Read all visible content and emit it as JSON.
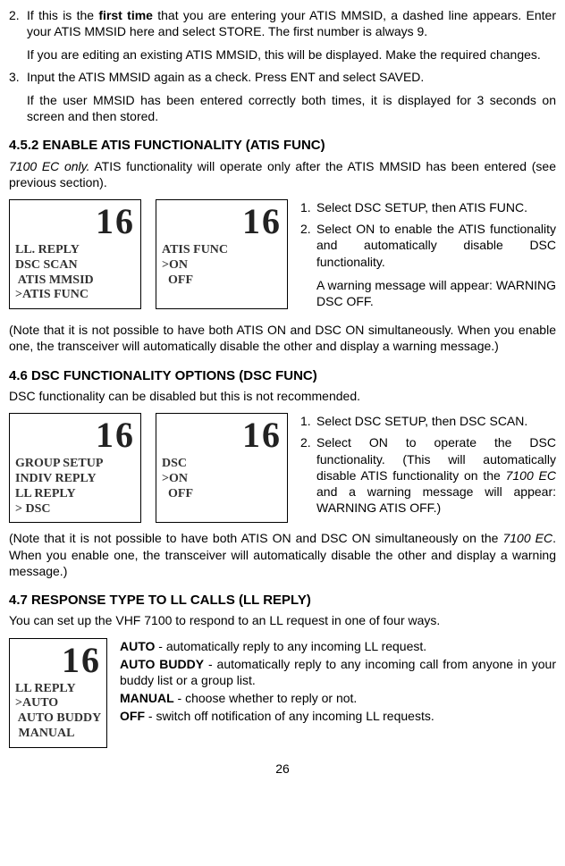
{
  "section_a": {
    "item2_num": "2.",
    "item2_text_pre": "If this is the ",
    "item2_bold": "first time",
    "item2_text_post": " that you are entering your ATIS MMSID, a dashed line appears. Enter your ATIS MMSID here and select STORE. The first number is always 9.",
    "item2_sub": "If you are editing an existing ATIS MMSID, this will be displayed. Make the required changes.",
    "item3_num": "3.",
    "item3_text": "Input the ATIS MMSID again as a check. Press ENT and select SAVED.",
    "item3_sub": "If the user MMSID has been entered correctly both times, it is displayed for 3 seconds on screen and then stored."
  },
  "sec452": {
    "title": "4.5.2 ENABLE ATIS FUNCTIONALITY (ATIS FUNC)",
    "intro_italic": "7100 EC only.",
    "intro_rest": " ATIS functionality will operate only after the ATIS MMSID has been entered (see previous section).",
    "screen1": {
      "ch": "16",
      "l1": "LL. REPLY",
      "l2": "DSC SCAN",
      "l3": " ATIS MMSID",
      "l4": ">ATIS FUNC"
    },
    "screen2": {
      "ch": "16",
      "l1": "ATIS FUNC",
      "l2": ">ON",
      "l3": "  OFF"
    },
    "step1_num": "1.",
    "step1": "Select DSC SETUP, then ATIS FUNC.",
    "step2_num": "2.",
    "step2": "Select ON to enable the ATIS functionality and automatically disable DSC functionality.",
    "step2_sub": "A warning message will appear: WARNING DSC OFF.",
    "note": "(Note that it is not possible to have both ATIS ON and DSC ON simultaneously. When you enable one, the transceiver will automatically disable the other and display a warning message.)"
  },
  "sec46": {
    "title": "4.6 DSC FUNCTIONALITY OPTIONS (DSC FUNC)",
    "intro": "DSC functionality can be disabled but this is not recommended.",
    "screen1": {
      "ch": "16",
      "l1": "GROUP SETUP",
      "l2": "INDIV REPLY",
      "l3": "LL REPLY",
      "l4": "> DSC"
    },
    "screen2": {
      "ch": "16",
      "l1": "DSC",
      "l2": ">ON",
      "l3": "  OFF"
    },
    "step1_num": "1.",
    "step1": "Select DSC SETUP, then DSC SCAN.",
    "step2_num": "2.",
    "step2_a": "Select ON to operate the DSC functionality. (This will automatically disable ATIS functionality  on the ",
    "step2_it": "7100 EC",
    "step2_b": "  and a warning message will appear: WARNING ATIS OFF.)",
    "note_a": "(Note that it is not possible to have both ATIS ON and DSC ON simultaneously on the ",
    "note_it": "7100 EC",
    "note_b": ". When you enable one, the transceiver will automatically disable the other and display a warning message.)"
  },
  "sec47": {
    "title": "4.7 RESPONSE TYPE TO LL CALLS (LL REPLY)",
    "intro": "You can set up the VHF 7100 to respond to an LL request in one of four ways.",
    "screen": {
      "ch": "16",
      "l1": "LL REPLY",
      "l2": ">AUTO",
      "l3": " AUTO BUDDY",
      "l4": " MANUAL"
    },
    "auto_b": "AUTO",
    "auto_t": " - automatically reply to any incoming LL request.",
    "autob_b": "AUTO BUDDY",
    "autob_t": " - automatically reply to any incoming call from anyone in your buddy list or a group list.",
    "man_b": "MANUAL",
    "man_t": " - choose whether to reply or not.",
    "off_b": "OFF",
    "off_t": " - switch off notification of any incoming LL requests."
  },
  "page": "26"
}
